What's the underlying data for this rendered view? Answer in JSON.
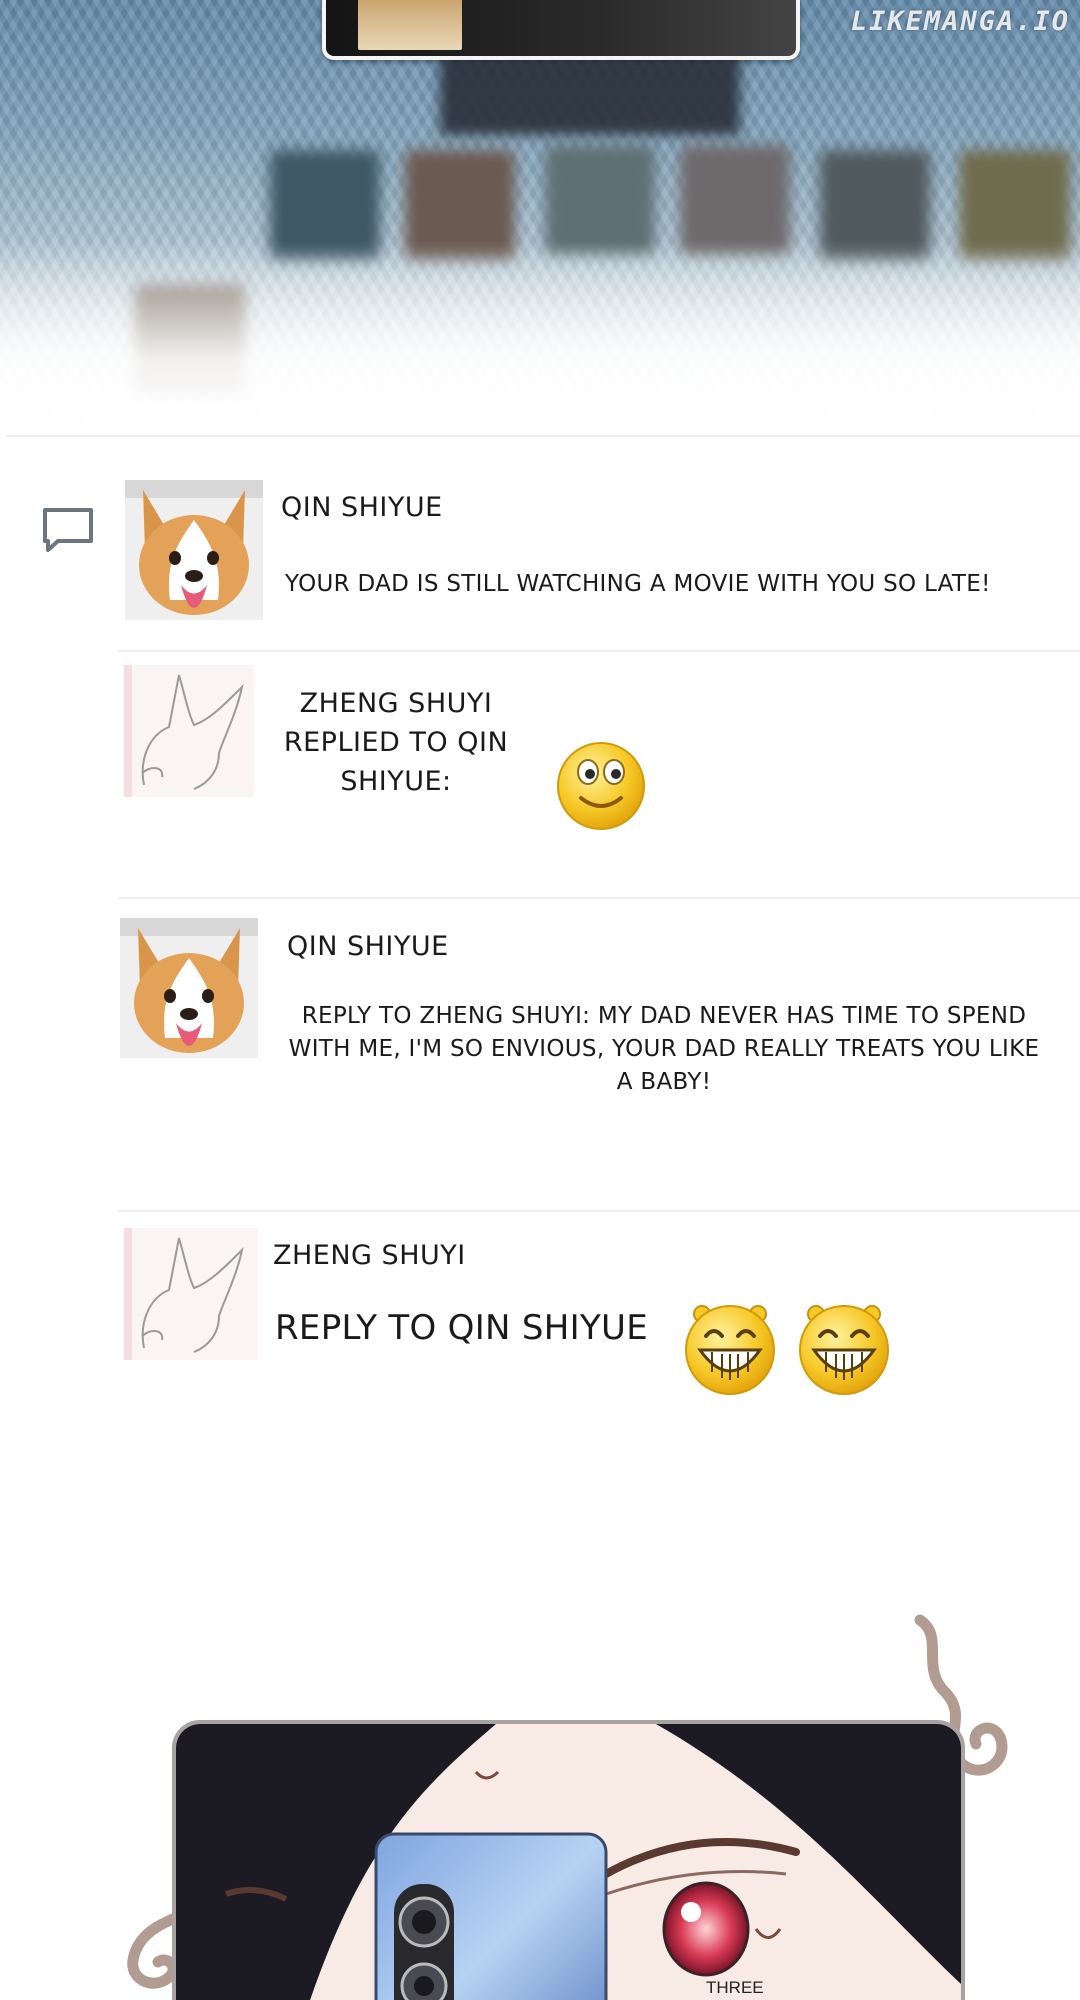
{
  "watermark": "LIKEMANGA.IO",
  "comments": [
    {
      "username": "QIN SHIYUE",
      "text": "YOUR DAD IS STILL WATCHING A MOVIE WITH YOU SO LATE!",
      "avatar": "corgi-avatar"
    },
    {
      "username": "ZHENG SHUYI\nREPLIED TO QIN\nSHIYUE:",
      "text": "",
      "avatar": "fox-sketch-avatar",
      "emoji": [
        "smile-emoji"
      ]
    },
    {
      "username": "QIN SHIYUE",
      "text": "REPLY TO ZHENG SHUYI: MY DAD NEVER HAS TIME TO SPEND WITH ME, I'M SO ENVIOUS, YOUR DAD REALLY TREATS YOU LIKE A BABY!",
      "avatar": "corgi-avatar"
    },
    {
      "username": "ZHENG SHUYI",
      "text": "REPLY TO QIN SHIYUE",
      "avatar": "fox-sketch-avatar",
      "emoji": [
        "grin-emoji",
        "grin-emoji"
      ]
    }
  ],
  "panel": {
    "sfx": "THREE"
  },
  "colors": {
    "text": "#1a1a1a",
    "divider": "#eeeeee",
    "emoji_yellow": "#f5c518",
    "icon": "#6b7680"
  }
}
